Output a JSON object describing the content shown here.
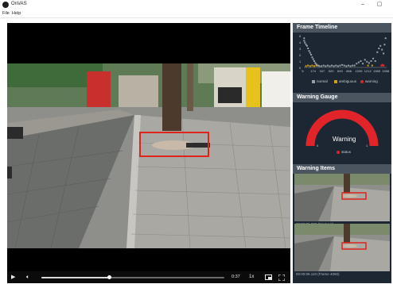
{
  "window": {
    "title": "OnVAS",
    "minimize": "–",
    "maximize": "▢"
  },
  "menu": [
    {
      "label": "File"
    },
    {
      "label": "Help"
    }
  ],
  "player": {
    "time": "0:37",
    "progress_fraction": 0.37,
    "play_icon": "play-icon",
    "volume_icon": "volume-icon",
    "speed_label": "1x",
    "pip_icon": "picture-in-picture-icon",
    "fullscreen_icon": "fullscreen-icon"
  },
  "timeline_panel": {
    "title": "Frame Timeline",
    "y_ticks": [
      "5",
      "4",
      "3",
      "2",
      "1",
      "0"
    ],
    "x_ticks": [
      "5",
      "174",
      "347",
      "520",
      "693",
      "866",
      "1039",
      "1212",
      "1385",
      "1558"
    ],
    "legend": [
      {
        "label": "normal",
        "color": "#9aa0a6"
      },
      {
        "label": "ambiguous",
        "color": "#d4a017"
      },
      {
        "label": "warning",
        "color": "#d9262c"
      }
    ],
    "chart_data": {
      "type": "scatter",
      "x_ticks": [
        5,
        174,
        347,
        520,
        693,
        866,
        1039,
        1212,
        1385,
        1558
      ],
      "ylim": [
        0,
        5
      ],
      "series": [
        {
          "name": "normal",
          "color": "#9aa0a6",
          "points": [
            [
              5,
              4.6
            ],
            [
              5,
              4.2
            ],
            [
              20,
              3.9
            ],
            [
              40,
              3.6
            ],
            [
              60,
              3.4
            ],
            [
              80,
              3.0
            ],
            [
              100,
              2.6
            ],
            [
              120,
              2.3
            ],
            [
              140,
              2.0
            ],
            [
              160,
              1.6
            ],
            [
              180,
              1.3
            ],
            [
              200,
              1.0
            ],
            [
              220,
              0.7
            ],
            [
              240,
              0.5
            ],
            [
              260,
              0.3
            ],
            [
              280,
              0.3
            ],
            [
              300,
              0.2
            ],
            [
              340,
              0.2
            ],
            [
              380,
              0.3
            ],
            [
              420,
              0.2
            ],
            [
              460,
              0.3
            ],
            [
              500,
              0.2
            ],
            [
              540,
              0.3
            ],
            [
              580,
              0.2
            ],
            [
              620,
              0.3
            ],
            [
              660,
              0.2
            ],
            [
              700,
              0.3
            ],
            [
              740,
              0.4
            ],
            [
              780,
              0.3
            ],
            [
              820,
              0.2
            ],
            [
              860,
              0.3
            ],
            [
              900,
              0.2
            ],
            [
              940,
              0.3
            ],
            [
              980,
              0.3
            ],
            [
              1020,
              0.6
            ],
            [
              1060,
              0.8
            ],
            [
              1100,
              1.0
            ],
            [
              1140,
              0.6
            ],
            [
              1180,
              1.2
            ],
            [
              1220,
              0.9
            ],
            [
              1260,
              0.7
            ],
            [
              1300,
              1.0
            ],
            [
              1340,
              1.4
            ],
            [
              1380,
              1.0
            ],
            [
              1420,
              2.4
            ],
            [
              1450,
              3.0
            ],
            [
              1480,
              3.4
            ],
            [
              1510,
              2.8
            ],
            [
              1540,
              2.2
            ],
            [
              1560,
              3.6
            ],
            [
              1580,
              4.6
            ]
          ]
        },
        {
          "name": "ambiguous",
          "color": "#d4a017",
          "points": [
            [
              40,
              0.2
            ],
            [
              80,
              0.3
            ],
            [
              120,
              0.2
            ],
            [
              160,
              0.3
            ],
            [
              200,
              0.2
            ],
            [
              240,
              0.3
            ],
            [
              1240,
              0.3
            ],
            [
              1320,
              0.3
            ]
          ]
        },
        {
          "name": "warning",
          "color": "#d9262c",
          "points": [
            [
              1500,
              0.3
            ],
            [
              1520,
              0.4
            ],
            [
              1540,
              0.3
            ]
          ]
        }
      ]
    }
  },
  "gauge_panel": {
    "title": "Warning Gauge",
    "label": "Warning",
    "status_legend": "status",
    "min": "0",
    "max": "1",
    "level_fraction": 1.0
  },
  "items_panel": {
    "title": "Warning Items",
    "captions": [
      "00:00:05.000 (Frame 5)",
      "00:00:06.110 (Frame 4060)"
    ]
  }
}
